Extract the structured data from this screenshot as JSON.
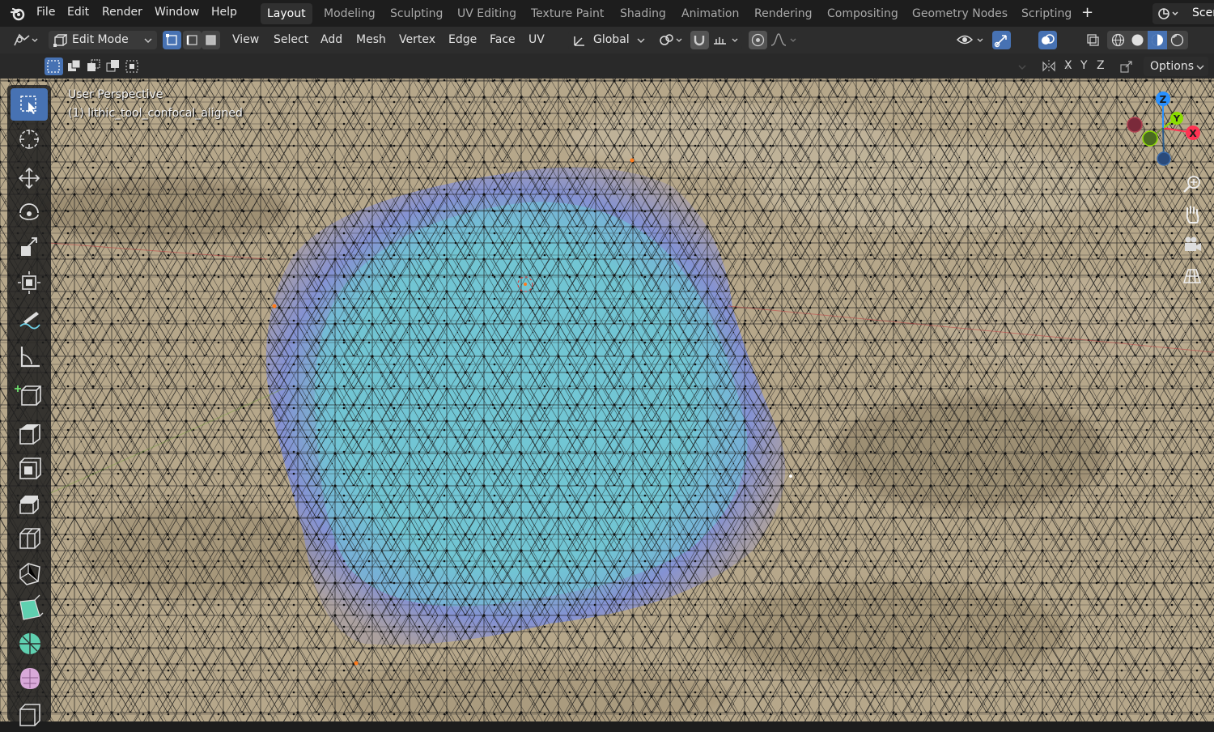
{
  "menubar": {
    "items": [
      "File",
      "Edit",
      "Render",
      "Window",
      "Help"
    ],
    "workspaces": [
      "Layout",
      "Modeling",
      "Sculpting",
      "UV Editing",
      "Texture Paint",
      "Shading",
      "Animation",
      "Rendering",
      "Compositing",
      "Geometry Nodes",
      "Scripting"
    ],
    "active_workspace": "Layout",
    "add_tab": "+",
    "scene_label": "Scer"
  },
  "header": {
    "mode": "Edit Mode",
    "menus": [
      "View",
      "Select",
      "Add",
      "Mesh",
      "Vertex",
      "Edge",
      "Face",
      "UV"
    ],
    "orientation": "Global"
  },
  "toolrow": {
    "axes": [
      "X",
      "Y",
      "Z"
    ],
    "options": "Options"
  },
  "viewport": {
    "perspective": "User Perspective",
    "object": "(1) lithic_tool_confocal_aligned"
  },
  "gizmo": {
    "x": "X",
    "y": "Y",
    "z": "Z",
    "colors": {
      "x": "#ff3352",
      "y": "#8bdc00",
      "z": "#2890ff"
    }
  },
  "colors": {
    "accent": "#4772b3",
    "surface": "#b9a98a",
    "selection": "#7ad0e0",
    "falloff": "#7a7ae0"
  }
}
